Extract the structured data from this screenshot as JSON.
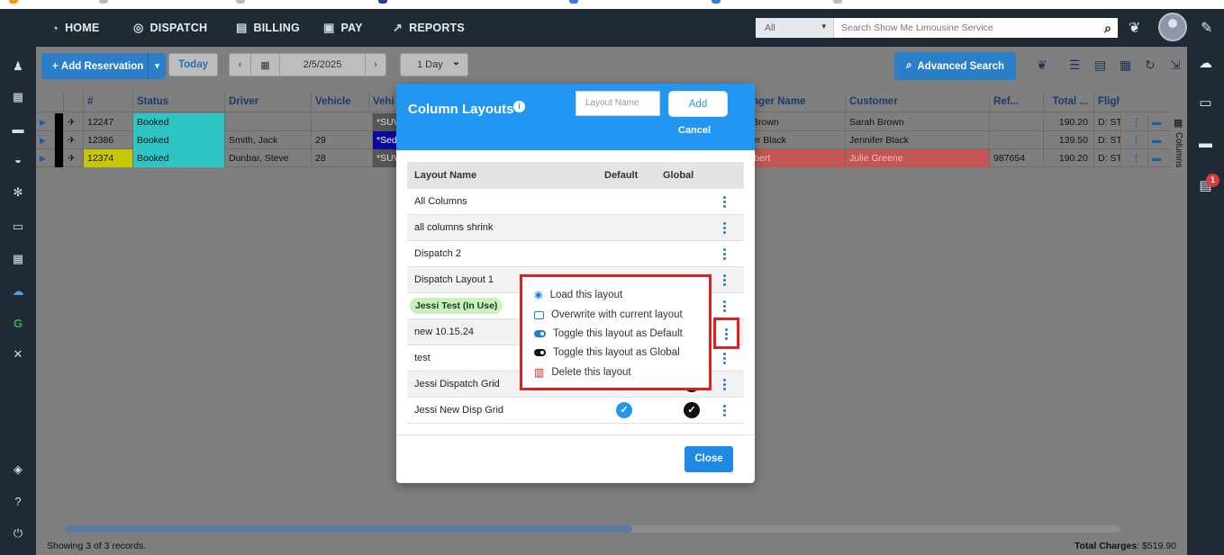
{
  "nav": {
    "items": [
      {
        "label": "HOME",
        "icon": "speedometer-icon"
      },
      {
        "label": "DISPATCH",
        "icon": "headset-icon"
      },
      {
        "label": "BILLING",
        "icon": "file-icon"
      },
      {
        "label": "PAY",
        "icon": "money-icon"
      },
      {
        "label": "REPORTS",
        "icon": "chart-icon"
      }
    ],
    "search_scope": "All",
    "search_placeholder": "Search Show Me Limousine Service"
  },
  "toolbar": {
    "add_label": "Add Reservation",
    "today_label": "Today",
    "date_value": "2/5/2025",
    "range_value": "1 Day",
    "advanced_search_label": "Advanced Search"
  },
  "grid": {
    "columns": [
      "#",
      "Status",
      "Driver",
      "Vehicle",
      "Vehi",
      "nger Name",
      "Customer",
      "Ref...",
      "Total ...",
      "Fligh"
    ],
    "rows": [
      {
        "num": "12247",
        "status": "Booked",
        "driver": "",
        "vehicle": "",
        "vtype": "*SUV",
        "pax": "Brown",
        "customer": "Sarah Brown",
        "ref": "",
        "total": "190.20",
        "flight": "D: STI"
      },
      {
        "num": "12386",
        "status": "Booked",
        "driver": "Smith, Jack",
        "vehicle": "29",
        "vtype": "*Seda",
        "pax": "er Black",
        "customer": "Jennifer Black",
        "ref": "",
        "total": "139.50",
        "flight": "D: STI"
      },
      {
        "num": "12374",
        "status": "Booked",
        "driver": "Dunbar, Steve",
        "vehicle": "28",
        "vtype": "*SUV",
        "pax": "lbert",
        "customer": "Julie Greene",
        "ref": "987654",
        "total": "190.20",
        "flight": "D: STI"
      }
    ],
    "side_label": "Columns",
    "footer_records": "Showing 3 of 3 records.",
    "total_charges_label": "Total Charges",
    "total_charges_value": ": $519.90"
  },
  "sidebar_badge": "1",
  "modal": {
    "title": "Column Layouts",
    "layout_name_placeholder": "Layout Name",
    "add_label": "Add",
    "cancel_label": "Cancel",
    "headers": {
      "name": "Layout Name",
      "default": "Default",
      "global": "Global"
    },
    "layouts": [
      {
        "name": "All Columns",
        "default": false,
        "global": false
      },
      {
        "name": "all columns shrink",
        "default": false,
        "global": false
      },
      {
        "name": "Dispatch 2",
        "default": false,
        "global": false
      },
      {
        "name": "Dispatch Layout 1",
        "default": false,
        "global": false
      },
      {
        "name": "Jessi Test (In Use)",
        "in_use": true,
        "default": false,
        "global": false
      },
      {
        "name": "new 10.15.24",
        "default": false,
        "global": false
      },
      {
        "name": "test",
        "default": false,
        "global": false
      },
      {
        "name": "Jessi Dispatch Grid",
        "default": false,
        "global": true
      },
      {
        "name": "Jessi New Disp Grid",
        "default": true,
        "global": true
      }
    ],
    "close_label": "Close"
  },
  "context_menu": {
    "items": [
      {
        "label": "Load this layout",
        "icon": "eye-icon"
      },
      {
        "label": "Overwrite with current layout",
        "icon": "overwrite-icon"
      },
      {
        "label": "Toggle this layout as Default",
        "icon": "toggle-blue-icon"
      },
      {
        "label": "Toggle this layout as Global",
        "icon": "toggle-black-icon"
      },
      {
        "label": "Delete this layout",
        "icon": "trash-icon"
      }
    ]
  },
  "colors": {
    "nav_bg": "#1f2a35",
    "primary": "#2196f3",
    "status_booked": "#2fc4c4",
    "highlight_red": "#e02020",
    "in_use_green": "#c9f1c0"
  }
}
